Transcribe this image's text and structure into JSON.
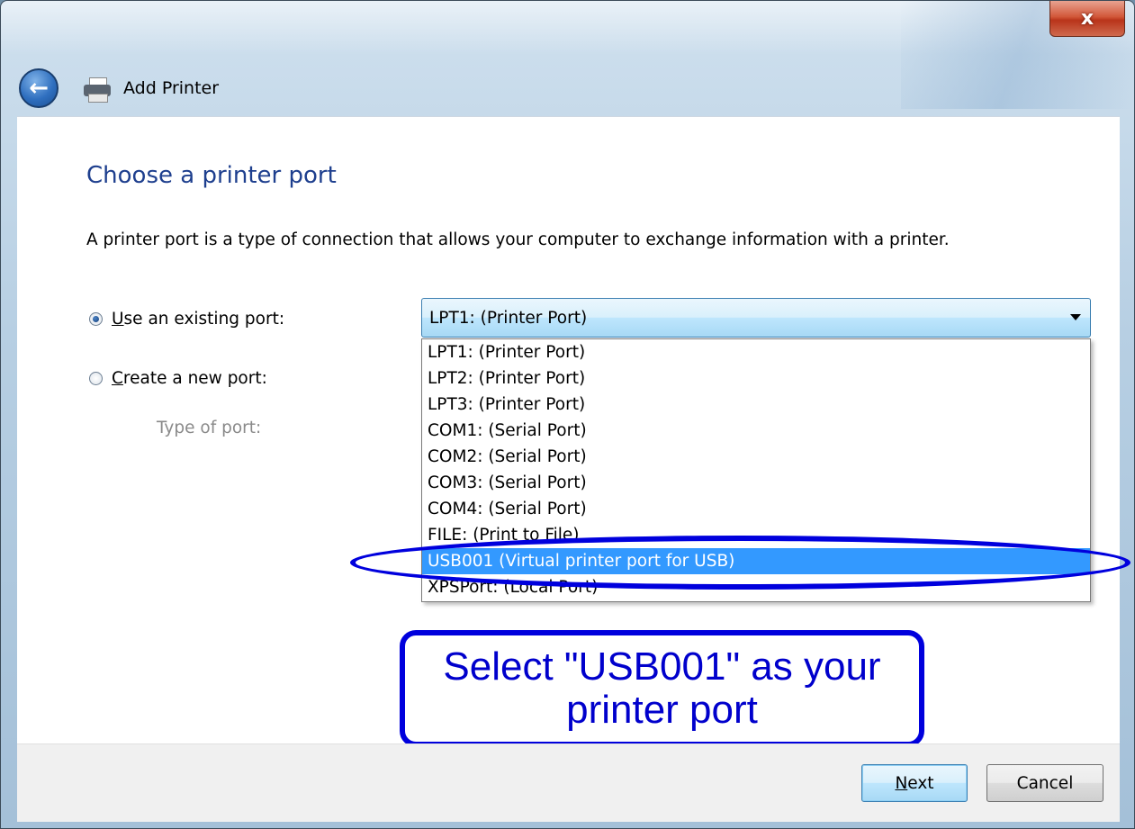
{
  "window": {
    "title": "Add Printer",
    "close_label": "x"
  },
  "icons": {
    "back": "back-arrow-icon",
    "printer": "printer-icon"
  },
  "page": {
    "heading": "Choose a printer port",
    "description": "A printer port is a type of connection that allows your computer to exchange information with a printer."
  },
  "options": {
    "existing_port_label": "Use an existing port:",
    "new_port_label": "Create a new port:",
    "type_of_port_label": "Type of port:",
    "selected_option": "existing"
  },
  "port_select": {
    "current_value": "LPT1: (Printer Port)",
    "items": [
      "LPT1: (Printer Port)",
      "LPT2: (Printer Port)",
      "LPT3: (Printer Port)",
      "COM1: (Serial Port)",
      "COM2: (Serial Port)",
      "COM3: (Serial Port)",
      "COM4: (Serial Port)",
      "FILE: (Print to File)",
      "USB001 (Virtual printer port for USB)",
      "XPSPort: (Local Port)"
    ],
    "highlighted_item": "USB001 (Virtual printer port for USB)"
  },
  "annotation": {
    "line1": "Select \"USB001\" as your",
    "line2": "printer port",
    "color": "#0000dd"
  },
  "footer": {
    "next_label": "Next",
    "cancel_label": "Cancel"
  }
}
